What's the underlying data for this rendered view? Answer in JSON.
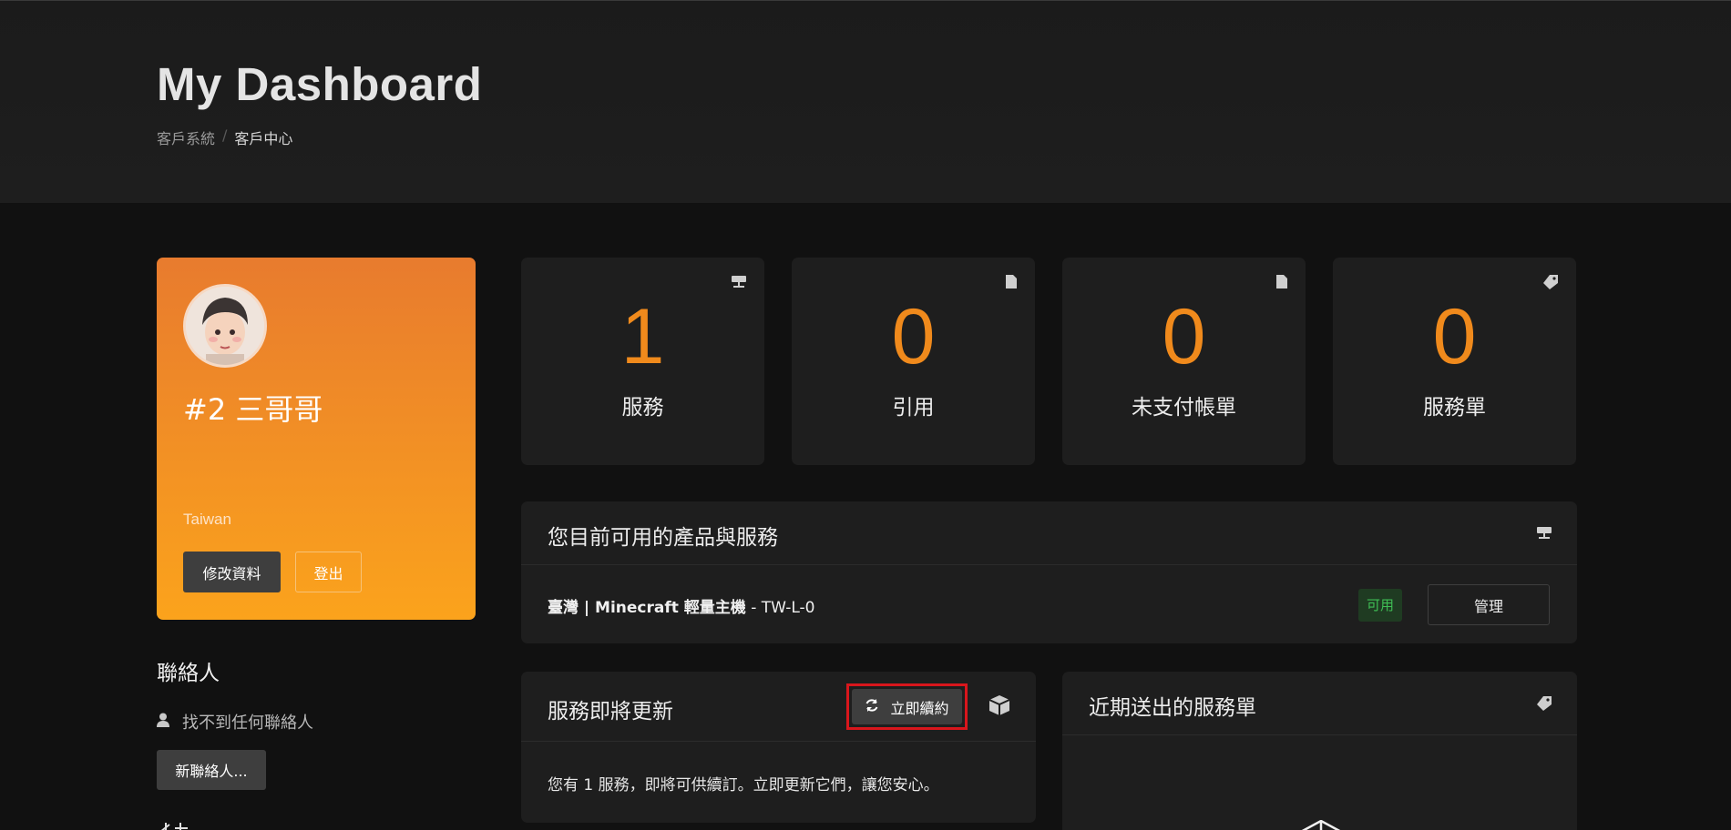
{
  "header": {
    "title": "My Dashboard",
    "breadcrumb": [
      "客戶系統",
      "客戶中心"
    ]
  },
  "profile": {
    "name": "#2 三哥哥",
    "country": "Taiwan",
    "edit_label": "修改資料",
    "logout_label": "登出",
    "gradient": [
      "#e87b2e",
      "#fba31c"
    ]
  },
  "contacts": {
    "title": "聯絡人",
    "empty_text": "找不到任何聯絡人",
    "new_label": "新聯絡人..."
  },
  "stats": [
    {
      "value": "1",
      "label": "服務",
      "icon": "server-icon"
    },
    {
      "value": "0",
      "label": "引用",
      "icon": "document-icon"
    },
    {
      "value": "0",
      "label": "未支付帳單",
      "icon": "document-icon"
    },
    {
      "value": "0",
      "label": "服務單",
      "icon": "tag-icon"
    }
  ],
  "services_panel": {
    "title": "您目前可用的產品與服務",
    "item": {
      "name": "臺灣 | Minecraft 輕量主機",
      "suffix": " - TW-L-0",
      "status": "可用",
      "manage_label": "管理"
    }
  },
  "renewals_panel": {
    "title": "服務即將更新",
    "renew_label": "立即續約",
    "body": "您有 1 服務，即將可供續訂。立即更新它們，讓您安心。"
  },
  "tickets_panel": {
    "title": "近期送出的服務單"
  },
  "colors": {
    "accent": "#f08a1c",
    "highlight_box": "#d9161c",
    "status_green": "#3fbf55"
  }
}
